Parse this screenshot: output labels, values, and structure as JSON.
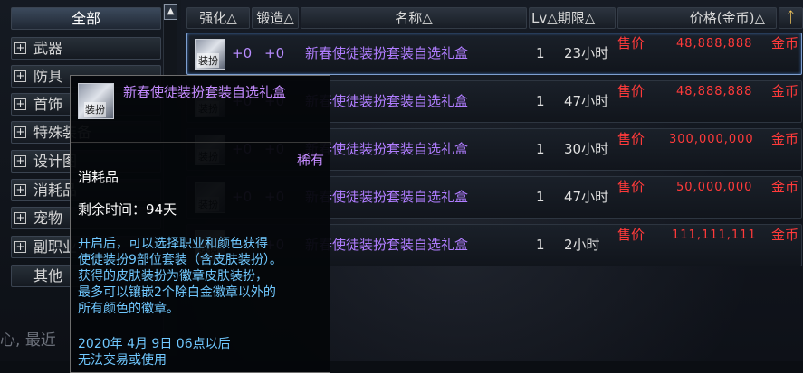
{
  "sidebar": {
    "items": [
      {
        "label": "全部",
        "plus": ""
      },
      {
        "label": "武器",
        "plus": "+"
      },
      {
        "label": "防具",
        "plus": "+"
      },
      {
        "label": "首饰",
        "plus": "+"
      },
      {
        "label": "特殊装备",
        "plus": "+"
      },
      {
        "label": "设计图",
        "plus": "+"
      },
      {
        "label": "消耗品",
        "plus": "+"
      },
      {
        "label": "宠物",
        "plus": "+"
      },
      {
        "label": "副职业",
        "plus": "+"
      },
      {
        "label": "其他",
        "plus": ""
      }
    ],
    "recent_label": "最近",
    "recent_prefix": "心"
  },
  "header": {
    "strengthen": "强化△",
    "forge": "锻造△",
    "name": "名称△",
    "lv_period": "Lv△期限△",
    "price": "价格(金币)△",
    "icon": "key-icon",
    "icon_char": "ᛏ"
  },
  "rows": [
    {
      "icon_label": "装扮",
      "strengthen": "+0",
      "forge": "+0",
      "name": "新春使徒装扮套装自选礼盒",
      "lv": "1",
      "duration": "23小时",
      "status": "售价",
      "price": "48,888,888",
      "currency": "金币"
    },
    {
      "icon_label": "装扮",
      "strengthen": "+0",
      "forge": "+0",
      "name": "新春使徒装扮套装自选礼盒",
      "lv": "1",
      "duration": "47小时",
      "status": "售价",
      "price": "48,888,888",
      "currency": "金币"
    },
    {
      "icon_label": "装扮",
      "strengthen": "+0",
      "forge": "+0",
      "name": "新春使徒装扮套装自选礼盒",
      "lv": "1",
      "duration": "30小时",
      "status": "售价",
      "price": "300,000,000",
      "currency": "金币"
    },
    {
      "icon_label": "装扮",
      "strengthen": "+0",
      "forge": "+0",
      "name": "新春使徒装扮套装自选礼盒",
      "lv": "1",
      "duration": "47小时",
      "status": "售价",
      "price": "50,000,000",
      "currency": "金币"
    },
    {
      "icon_label": "装扮",
      "strengthen": "+0",
      "forge": "+0",
      "name": "新春使徒装扮套装自选礼盒",
      "lv": "1",
      "duration": "2小时",
      "status": "售价",
      "price": "111,111,111",
      "currency": "金币"
    }
  ],
  "tooltip": {
    "icon_label": "装扮",
    "title": "新春使徒装扮套装自选礼盒",
    "rarity": "稀有",
    "type": "消耗品",
    "remaining": "剩余时间：94天",
    "desc": [
      "开启后，可以选择职业和颜色获得",
      "使徒装扮9部位套装（含皮肤装扮）。",
      "获得的皮肤装扮为徽章皮肤装扮，",
      "最多可以镶嵌2个除白金徽章以外的",
      "所有颜色的徽章。"
    ],
    "date_lines": [
      "2020年 4月 9日 06点以后",
      "无法交易或使用"
    ]
  },
  "colors": {
    "accent_purple": "#b07dff",
    "price_red": "#ff3a3a",
    "desc_blue": "#70c8ff"
  }
}
